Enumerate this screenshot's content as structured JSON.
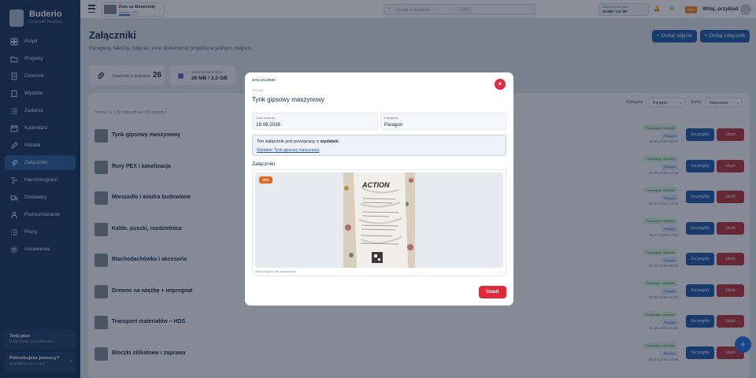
{
  "brand": {
    "name": "Buderio",
    "subtitle": "Dziennik Budowy"
  },
  "sidebar": {
    "items": [
      {
        "label": "Pulpit",
        "icon": "dashboard-icon"
      },
      {
        "label": "Projekty",
        "icon": "folder-icon"
      },
      {
        "label": "Dziennik",
        "icon": "journal-icon"
      },
      {
        "label": "Wydatki",
        "icon": "receipt-icon"
      },
      {
        "label": "Zadania",
        "icon": "tasks-icon"
      },
      {
        "label": "Kalendarz",
        "icon": "calendar-icon"
      },
      {
        "label": "Notatki",
        "icon": "pencil-icon"
      },
      {
        "label": "Załączniki",
        "icon": "paperclip-icon",
        "active": true
      },
      {
        "label": "Harmonogram",
        "icon": "gantt-icon"
      },
      {
        "label": "Dostawcy",
        "icon": "truck-icon"
      },
      {
        "label": "Podsumowanie",
        "icon": "users-icon"
      },
      {
        "label": "Plany",
        "icon": "list-icon"
      },
      {
        "label": "Ustawienia",
        "icon": "gear-icon"
      }
    ],
    "plan": {
      "title": "Twój plan",
      "subtitle": "Kody, limity i przedłużenie →"
    },
    "help": {
      "title": "Potrzebujesz pomocy?",
      "subtitle": "Skontaktuj się z nami"
    }
  },
  "topbar": {
    "project": {
      "name": "Dom na Słonecznej",
      "budget": "Wydano: 64%",
      "progress": 0.64
    },
    "search_placeholder": "Szukaj w projekcie…",
    "search_shortcut": "Ctrl K",
    "storage": {
      "label": "Wykorzystane dane",
      "value": "26 MB / 2,0 GB"
    },
    "pro_badge": "PRO",
    "greeting": "Witaj, przyklad"
  },
  "page": {
    "title": "Załączniki",
    "subtitle": "Paragony, faktury, zdjęcia i inne dokumenty projektu w jednym miejscu.",
    "add_photo": "+ Dodaj zdjęcie",
    "add_attachment": "+ Dodaj załącznik"
  },
  "stats": {
    "count_label": "Załączniki w projekcie",
    "count_value": "26",
    "storage_label": "Wykorzystane dane",
    "storage_value": "26 MB / 2,0 GB"
  },
  "list": {
    "meta": "Strona 1 z 1 (9 załączników, 9M aktywny)",
    "category_label": "Kategoria",
    "category_value": "Paragon",
    "sort_label": "Sortuj",
    "sort_value": "Najnowsze",
    "detail_label": "Szczegóły",
    "delete_label": "Usuń",
    "rows": [
      {
        "name": "Tynk gipsowy maszynowy",
        "badge1": "Powiązany: Wydatek",
        "badge2": "Paragon",
        "date": "18.08.2026 09:05"
      },
      {
        "name": "Rury PEX i kanalizacja",
        "badge1": "Powiązany: Wydatek",
        "badge2": "Paragon",
        "date": "03.08.2026 12:10"
      },
      {
        "name": "Mieszadło i wiadra budowlane",
        "badge1": "Powiązany: Wydatek",
        "badge2": "Paragon",
        "date": "22.07.2026 14:30"
      },
      {
        "name": "Kable, puszki, rozdzielnica",
        "badge1": "Powiązany: Wydatek",
        "badge2": "Paragon",
        "date": "15.07.2026 17:20"
      },
      {
        "name": "Blachodachówka i akcesoria",
        "badge1": "Powiązany: Wydatek",
        "badge2": "Paragon",
        "date": "20.06.2026 09:50"
      },
      {
        "name": "Drewno na więźbę + impregnat",
        "badge1": "Powiązany: Wydatek",
        "badge2": "Paragon",
        "date": "02.06.2026 11:25"
      },
      {
        "name": "Transport materiałów – HDS",
        "badge1": "Powiązany: Wydatek",
        "badge2": "Paragon",
        "date": "19.05.2026 11:45"
      },
      {
        "name": "Bloczki silikatowe i zaprawa",
        "badge1": "Powiązany: Wydatek",
        "badge2": "Paragon",
        "date": "03.04.2026 10:05"
      }
    ]
  },
  "modal": {
    "kicker": "ZAŁĄCZNIK",
    "title_label": "TYTUŁ",
    "title": "Tynk gipsowy maszynowy",
    "date_label": "Data dodania",
    "date_value": "18.08.2026",
    "category_label": "Kategoria",
    "category_value": "Paragon",
    "info_prefix": "Ten załącznik jest powiązany z",
    "info_bold": "wydatek",
    "info_link": "Wydatek: Tynk gipsowy maszynowy",
    "attachments_heading": "Załączniki",
    "file_badge": "JPG",
    "receipt_brand": "ACTION",
    "hint": "Kliknij zdjęcie, aby powiększyć.",
    "delete_label": "Usuń"
  },
  "colors": {
    "sidebar": "#16335c",
    "primary": "#1f56a8",
    "danger": "#e0293a",
    "accent": "#e8651a"
  }
}
